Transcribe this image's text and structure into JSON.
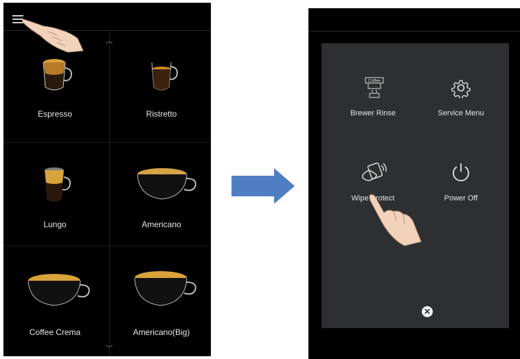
{
  "left_screen": {
    "tiles": [
      {
        "label": "Espresso"
      },
      {
        "label": "Ristretto"
      },
      {
        "label": "Lungo"
      },
      {
        "label": "Americano"
      },
      {
        "label": "Coffee Crema"
      },
      {
        "label": "Americano(Big)"
      }
    ]
  },
  "right_screen": {
    "menu_items": [
      {
        "label": "Brewer Rinse",
        "icon": "coffee-brewer-icon",
        "icon_text": "Coffee"
      },
      {
        "label": "Service Menu",
        "icon": "gear-icon"
      },
      {
        "label": "Wipe Protect",
        "icon": "hand-wipe-icon"
      },
      {
        "label": "Power Off",
        "icon": "power-icon"
      }
    ],
    "close_symbol": "✕"
  },
  "colors": {
    "screen_bg": "#000000",
    "panel_bg": "#2d2f30",
    "arrow": "#4f7fc2",
    "coffee": "#c9902a"
  }
}
